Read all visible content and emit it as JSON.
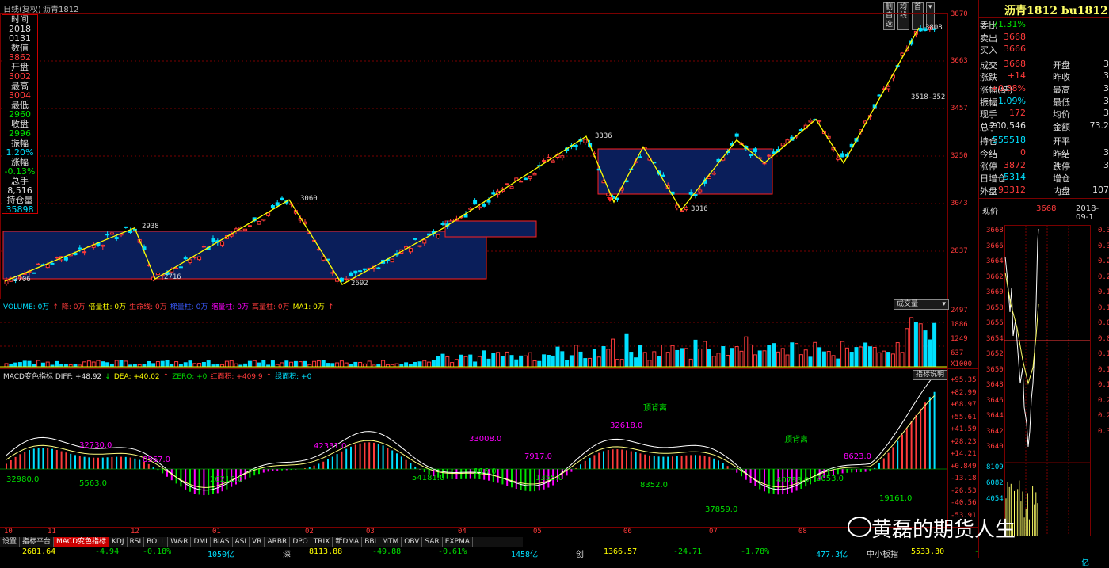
{
  "window": {
    "title": "日线(复权)",
    "symbol": "沥青1812"
  },
  "toolbar_buttons": [
    "删自选",
    "均线",
    "首",
    "▾"
  ],
  "info_box": [
    {
      "k": "时间",
      "v": "2018",
      "cls": "w"
    },
    {
      "k": "",
      "v": "0131",
      "cls": "w"
    },
    {
      "k": "数值",
      "v": "3862",
      "cls": "r"
    },
    {
      "k": "开盘",
      "v": "3002",
      "cls": "r"
    },
    {
      "k": "最高",
      "v": "3004",
      "cls": "r"
    },
    {
      "k": "最低",
      "v": "2960",
      "cls": "g"
    },
    {
      "k": "收盘",
      "v": "2996",
      "cls": "g"
    },
    {
      "k": "振幅",
      "v": "1.20%",
      "cls": "c"
    },
    {
      "k": "涨幅",
      "v": "-0.13%",
      "cls": "g"
    },
    {
      "k": "总手",
      "v": "8,516",
      "cls": "w"
    },
    {
      "k": "持仓量",
      "v": "35898",
      "cls": "c"
    }
  ],
  "price_axis": [
    "3870",
    "3663",
    "3457",
    "3250",
    "3043",
    "2837"
  ],
  "price_annotations": [
    {
      "text": "3808"
    },
    {
      "text": "3518-352"
    },
    {
      "text": "3336"
    },
    {
      "text": "3060"
    },
    {
      "text": "2938"
    },
    {
      "text": "2716"
    },
    {
      "text": "2706"
    },
    {
      "text": "2692"
    },
    {
      "text": "3016"
    }
  ],
  "volume_legend": [
    {
      "t": "VOLUME: 0万",
      "c": "#00e0ff"
    },
    {
      "t": "↑",
      "c": "#ff3b3b"
    },
    {
      "t": "降: 0万",
      "c": "#ff3b3b"
    },
    {
      "t": "倍量柱: 0万",
      "c": "#ffff00"
    },
    {
      "t": "生命线: 0万",
      "c": "#ff3b3b"
    },
    {
      "t": "梯量柱: 0万",
      "c": "#3b5bff"
    },
    {
      "t": "缩量柱: 0万",
      "c": "#ff00ff"
    },
    {
      "t": "高量柱: 0万",
      "c": "#ff3b3b"
    },
    {
      "t": "MA1: 0万",
      "c": "#ffff00"
    },
    {
      "t": "↑",
      "c": "#ff3b3b"
    }
  ],
  "volume_dropdown": "成交量",
  "volume_axis": [
    "2497",
    "1886",
    "1249",
    "637",
    "X1000"
  ],
  "macd_legend": [
    {
      "t": "MACD变色指标  DIFF: +48.92",
      "c": "#e0e0e0"
    },
    {
      "t": "↓",
      "c": "#00e000"
    },
    {
      "t": "DEA: +40.02",
      "c": "#ffff00"
    },
    {
      "t": "↑",
      "c": "#ff3b3b"
    },
    {
      "t": "ZERO: +0",
      "c": "#00e000"
    },
    {
      "t": "红面积: +409.9",
      "c": "#ff3b3b"
    },
    {
      "t": "↑",
      "c": "#ff3b3b"
    },
    {
      "t": "绿面积: +0",
      "c": "#00e0ff"
    }
  ],
  "macd_help": "指标说明",
  "macd_axis": [
    "+95.35",
    "+82.99",
    "+68.97",
    "+55.61",
    "+41.59",
    "+28.23",
    "+14.21",
    "+0.849",
    "-13.18",
    "-26.53",
    "-40.56",
    "-53.91"
  ],
  "macd_labels": [
    {
      "t": "32730.0",
      "c": "#ff00ff"
    },
    {
      "t": "32980.0",
      "c": "#00e000"
    },
    {
      "t": "8567.0",
      "c": "#ff00ff"
    },
    {
      "t": "5563.0",
      "c": "#00e000"
    },
    {
      "t": "26216.0",
      "c": "#00e000"
    },
    {
      "t": "42331.0",
      "c": "#ff00ff"
    },
    {
      "t": "54181.0",
      "c": "#00e000"
    },
    {
      "t": "33008.0",
      "c": "#ff00ff"
    },
    {
      "t": "116.0",
      "c": "#00e000"
    },
    {
      "t": "7917.0",
      "c": "#ff00ff"
    },
    {
      "t": "1355.0",
      "c": "#00e000"
    },
    {
      "t": "顶背离",
      "c": "#00e000"
    },
    {
      "t": "32618.0",
      "c": "#ff00ff"
    },
    {
      "t": "8352.0",
      "c": "#00e000"
    },
    {
      "t": "37859.0",
      "c": "#00e000"
    },
    {
      "t": "顶背离",
      "c": "#00e000"
    },
    {
      "t": "40788.0",
      "c": "#00e000"
    },
    {
      "t": "2053.0",
      "c": "#00e000"
    },
    {
      "t": "8623.0",
      "c": "#ff00ff"
    },
    {
      "t": "19161.0",
      "c": "#00e000"
    }
  ],
  "date_axis": [
    "10",
    "11",
    "12",
    "01",
    "02",
    "03",
    "04",
    "05",
    "06",
    "07",
    "08"
  ],
  "bottom_tabs": [
    "设置",
    "指标平台",
    "MACD变色指标",
    "KDJ",
    "RSI",
    "BOLL",
    "W&R",
    "DMI",
    "BIAS",
    "ASI",
    "VR",
    "ARBR",
    "DPO",
    "TRIX",
    "新DMA",
    "BBI",
    "MTM",
    "OBV",
    "SAR",
    "EXPMA"
  ],
  "bottom_tab_selected": 2,
  "status_bar": [
    {
      "t": "2681.64",
      "c": "#ffff00"
    },
    {
      "t": "-4.94",
      "c": "#00e000"
    },
    {
      "t": "-0.18%",
      "c": "#00e000"
    },
    {
      "t": "1050亿",
      "c": "#00e0ff"
    },
    {
      "t": "深",
      "c": "#ddd"
    },
    {
      "t": "8113.88",
      "c": "#ffff00"
    },
    {
      "t": "-49.88",
      "c": "#00e000"
    },
    {
      "t": "-0.61%",
      "c": "#00e000"
    },
    {
      "t": "1458亿",
      "c": "#00e0ff"
    },
    {
      "t": "创",
      "c": "#ddd"
    },
    {
      "t": "1366.57",
      "c": "#ffff00"
    },
    {
      "t": "-24.71",
      "c": "#00e000"
    },
    {
      "t": "-1.78%",
      "c": "#00e000"
    },
    {
      "t": "477.3亿",
      "c": "#00e0ff"
    },
    {
      "t": "中小板指",
      "c": "#ddd"
    },
    {
      "t": "5533.30",
      "c": "#ffff00"
    },
    {
      "t": "-22.66",
      "c": "#00e000"
    },
    {
      "t": "-0.41%",
      "c": "#00e000"
    },
    {
      "t": "602.5亿",
      "c": "#00e0ff"
    }
  ],
  "right_panel": {
    "title": "沥青1812 bu1812",
    "rows": [
      {
        "k": "委比",
        "v": "-71.31%",
        "vc": "#00e000"
      },
      {
        "k": "卖出",
        "v": "3668",
        "vc": "#ff3b3b"
      },
      {
        "k": "买入",
        "v": "3666",
        "vc": "#ff3b3b"
      },
      {
        "k": "成交",
        "v": "3668",
        "vc": "#ff3b3b",
        "k2": "开盘",
        "v2": "3"
      },
      {
        "k": "涨跌",
        "v": "+14",
        "vc": "#ff3b3b",
        "k2": "昨收",
        "v2": "3"
      },
      {
        "k": "涨幅(结)",
        "v": "+0.38%",
        "vc": "#ff3b3b",
        "k2": "最高",
        "v2": "3"
      },
      {
        "k": "振幅",
        "v": "1.09%",
        "vc": "#00e0ff",
        "k2": "最低",
        "v2": "3"
      },
      {
        "k": "现手",
        "v": "172",
        "vc": "#ff3b3b",
        "k2": "均价",
        "v2": "3"
      },
      {
        "k": "总手",
        "v": "200,546",
        "vc": "#e0e0e0",
        "k2": "金额",
        "v2": "73.2"
      },
      {
        "k": "持仓",
        "v": "555518",
        "vc": "#00e0ff",
        "k2": "开平",
        "v2": ""
      },
      {
        "k": "今结",
        "v": "0",
        "vc": "#ff3b3b",
        "k2": "昨结",
        "v2": "3"
      },
      {
        "k": "涨停",
        "v": "3872",
        "vc": "#ff3b3b",
        "k2": "跌停",
        "v2": "3"
      },
      {
        "k": "日增仓",
        "v": "-5314",
        "vc": "#00e0ff",
        "k2": "增仓",
        "v2": ""
      },
      {
        "k": "外盘",
        "v": "93312",
        "vc": "#ff3b3b",
        "k2": "内盘",
        "v2": "107"
      }
    ],
    "now_label": "现价",
    "now_value": "3668",
    "now_date": "2018-09-1",
    "mini_axis": [
      "3668",
      "3666",
      "3664",
      "3662",
      "3660",
      "3658",
      "3656",
      "3654",
      "3652",
      "3650",
      "3648",
      "3646",
      "3644",
      "3642",
      "3640",
      "8109",
      "6082",
      "4054"
    ],
    "mini_right_axis": [
      "0.3",
      "0.3",
      "0.2",
      "0.2",
      "0.1",
      "0.1",
      "0.0",
      "0.0",
      "0.1",
      "0.1",
      "0.1",
      "0.2",
      "0.2",
      "0.3"
    ]
  },
  "watermark": "黄磊的期货人生",
  "chart_data": {
    "type": "candlestick",
    "zigzag_points": [
      2706,
      2938,
      2716,
      3060,
      2692,
      2938,
      3336,
      3016,
      3250,
      3808
    ],
    "ylim": [
      2700,
      3870
    ]
  }
}
